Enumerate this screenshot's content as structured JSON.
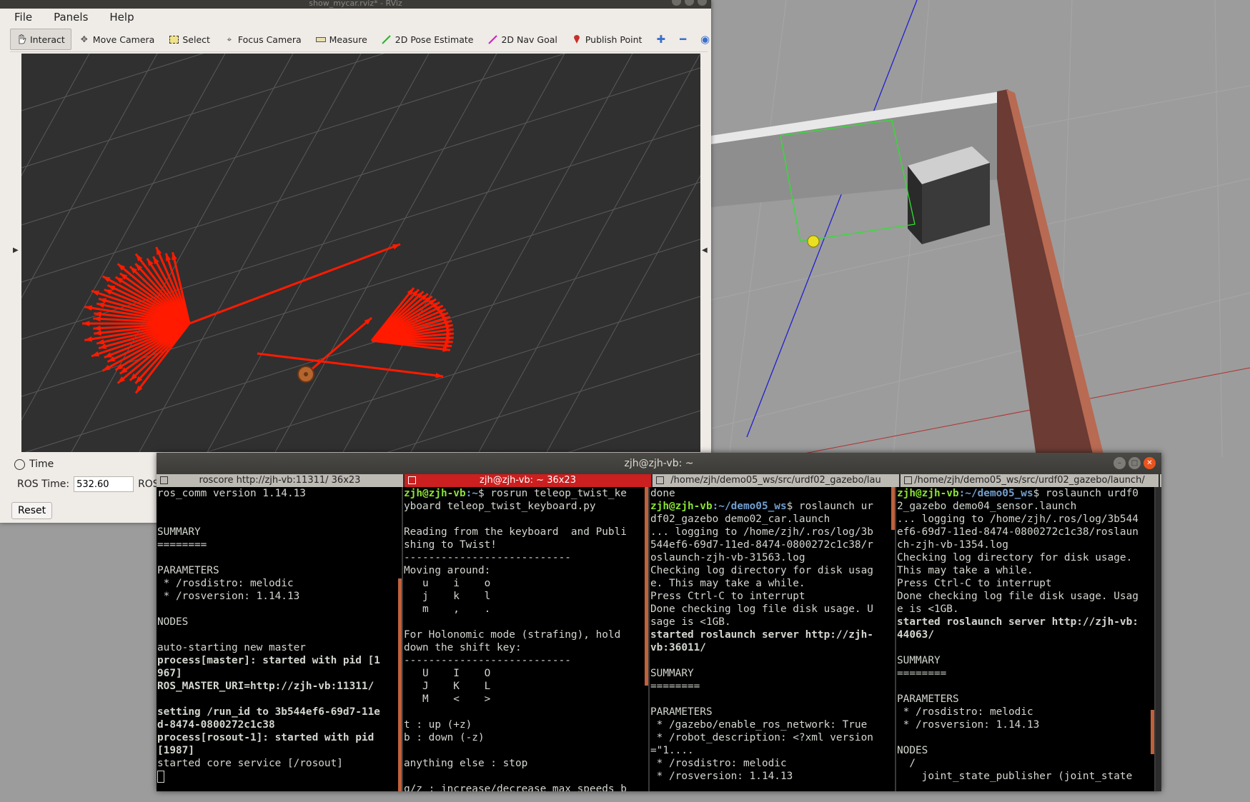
{
  "rviz": {
    "window_title": "show_mycar.rviz* - RViz",
    "menu": [
      "File",
      "Panels",
      "Help"
    ],
    "toolbar": [
      {
        "label": "Interact",
        "icon": "hand-icon",
        "active": true
      },
      {
        "label": "Move Camera",
        "icon": "move-camera-icon"
      },
      {
        "label": "Select",
        "icon": "select-icon"
      },
      {
        "label": "Focus Camera",
        "icon": "focus-camera-icon"
      },
      {
        "label": "Measure",
        "icon": "measure-icon"
      },
      {
        "label": "2D Pose Estimate",
        "icon": "green-arrow-icon"
      },
      {
        "label": "2D Nav Goal",
        "icon": "magenta-arrow-icon"
      },
      {
        "label": "Publish Point",
        "icon": "map-pin-icon"
      }
    ],
    "time_panel": {
      "title": "Time",
      "ros_time_label": "ROS Time:",
      "ros_time_value": "532.60",
      "ros_elapsed_label": "ROS",
      "reset_label": "Reset"
    }
  },
  "terminal": {
    "title": "zjh@zjh-vb: ~",
    "tabs": [
      {
        "label": "roscore http://zjh-vb:11311/ 36x23",
        "active": false
      },
      {
        "label": "zjh@zjh-vb: ~ 36x23",
        "active": true
      },
      {
        "label": "/home/zjh/demo05_ws/src/urdf02_gazebo/lau",
        "active": false
      },
      {
        "label": "/home/zjh/demo05_ws/src/urdf02_gazebo/launch/",
        "active": false
      }
    ],
    "pane1": [
      "ros_comm version 1.14.13",
      "",
      "",
      "SUMMARY",
      "========",
      "",
      "PARAMETERS",
      " * /rosdistro: melodic",
      " * /rosversion: 1.14.13",
      "",
      "NODES",
      "",
      "auto-starting new master",
      "process[master]: started with pid [1",
      "967]",
      "ROS_MASTER_URI=http://zjh-vb:11311/",
      "",
      "setting /run_id to 3b544ef6-69d7-11e",
      "d-8474-0800272c1c38",
      "process[rosout-1]: started with pid",
      "[1987]",
      "started core service [/rosout]"
    ],
    "pane2_prompt_user": "zjh@zjh-vb",
    "pane2_prompt_path": ":~",
    "pane2_cmd": "$ rosrun teleop_twist_ke",
    "pane2": [
      "yboard teleop_twist_keyboard.py",
      "",
      "Reading from the keyboard  and Publi",
      "shing to Twist!",
      "---------------------------",
      "Moving around:",
      "   u    i    o",
      "   j    k    l",
      "   m    ,    .",
      "",
      "For Holonomic mode (strafing), hold",
      "down the shift key:",
      "---------------------------",
      "   U    I    O",
      "   J    K    L",
      "   M    <    >",
      "",
      "t : up (+z)",
      "b : down (-z)",
      "",
      "anything else : stop",
      "",
      "q/z : increase/decrease max speeds b"
    ],
    "pane3_top": "done",
    "pane3_prompt_user": "zjh@zjh-vb",
    "pane3_prompt_path": ":~/demo05_ws",
    "pane3_cmd": "$ roslaunch ur",
    "pane3": [
      "df02_gazebo demo02_car.launch",
      "... logging to /home/zjh/.ros/log/3b",
      "544ef6-69d7-11ed-8474-0800272c1c38/r",
      "oslaunch-zjh-vb-31563.log",
      "Checking log directory for disk usag",
      "e. This may take a while.",
      "Press Ctrl-C to interrupt",
      "Done checking log file disk usage. U",
      "sage is <1GB.",
      ""
    ],
    "pane3_bold": [
      "started roslaunch server http://zjh-",
      "vb:36011/"
    ],
    "pane3_tail": [
      "",
      "SUMMARY",
      "========",
      "",
      "PARAMETERS",
      " * /gazebo/enable_ros_network: True",
      " * /robot_description: <?xml version",
      "=\"1....",
      " * /rosdistro: melodic",
      " * /rosversion: 1.14.13"
    ],
    "pane4_prompt_user": "zjh@zjh-vb",
    "pane4_prompt_path": ":~/demo05_ws",
    "pane4_cmd": "$ roslaunch urdf0",
    "pane4": [
      "2_gazebo demo04_sensor.launch",
      "... logging to /home/zjh/.ros/log/3b544",
      "ef6-69d7-11ed-8474-0800272c1c38/roslaun",
      "ch-zjh-vb-1354.log",
      "Checking log directory for disk usage.",
      "This may take a while.",
      "Press Ctrl-C to interrupt",
      "Done checking log file disk usage. Usag",
      "e is <1GB.",
      ""
    ],
    "pane4_bold": [
      "started roslaunch server http://zjh-vb:",
      "44063/"
    ],
    "pane4_tail": [
      "",
      "SUMMARY",
      "========",
      "",
      "PARAMETERS",
      " * /rosdistro: melodic",
      " * /rosversion: 1.14.13",
      "",
      "NODES",
      "  /",
      "    joint_state_publisher (joint_state"
    ]
  },
  "colors": {
    "laser_arrows": "#ff1a00",
    "terminal_bg": "#000000",
    "active_tab": "#cc1f1f",
    "prompt_user": "#8ae234",
    "prompt_path": "#729fcf"
  }
}
